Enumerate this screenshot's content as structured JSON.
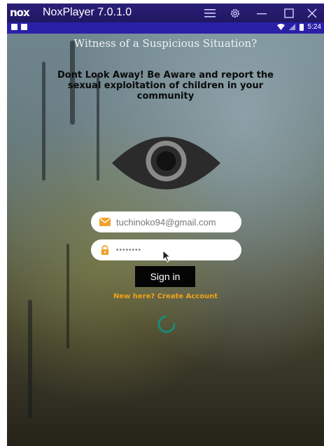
{
  "window": {
    "logo": "nox",
    "title": "NoxPlayer 7.0.1.0",
    "controls": [
      "menu-icon",
      "gear-icon",
      "minimize-icon",
      "maximize-icon",
      "close-icon"
    ]
  },
  "statusbar": {
    "time": "5:24",
    "icons": [
      "notification-icon",
      "facebook-icon",
      "wifi-icon",
      "signal-icon",
      "battery-icon"
    ]
  },
  "app": {
    "heading": "Witness of a Suspicious Situation?",
    "subheading": "Dont Look Away! Be Aware and report the sexual exploitation of children in your community",
    "email_value": "tuchinoko94@gmail.com",
    "password_value": "••••••••",
    "signin_label": "Sign in",
    "create_account_label": "New here? Create Account"
  },
  "colors": {
    "titlebar": "#241a6c",
    "statusbar": "#2a20a8",
    "accent_orange": "#f2a219",
    "spinner": "#1b8a7a",
    "eye": "#2b2b2b"
  }
}
